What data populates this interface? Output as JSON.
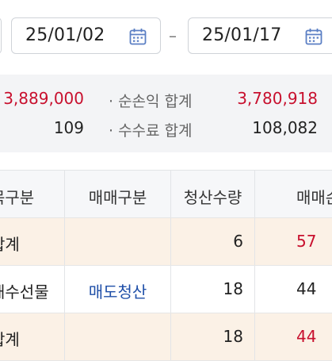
{
  "date_range": {
    "start": "25/01/02",
    "separator": "–",
    "end": "25/01/17",
    "icon": "calendar-icon"
  },
  "summary": {
    "row1": {
      "left_value": "3,889,000",
      "label": "· 순손익 합계",
      "right_value": "3,780,918"
    },
    "row2": {
      "left_value": "109",
      "label": "· 수수료 합계",
      "right_value": "108,082"
    }
  },
  "table": {
    "headers": [
      "목구분",
      "매매구분",
      "청산수량",
      "매매손"
    ],
    "rows": [
      {
        "col1": "합계",
        "col2": "",
        "col3": "6",
        "col4": "57"
      },
      {
        "col1": "해수선물",
        "col2": "매도청산",
        "col3": "18",
        "col4": "44"
      },
      {
        "col1": "합계",
        "col2": "",
        "col3": "18",
        "col4": "44"
      }
    ]
  },
  "colors": {
    "profit_red": "#c8102e",
    "link_blue": "#1f4fa8",
    "total_row_bg": "#fbf1e6",
    "summary_bg": "#f3f4f6",
    "icon_blue": "#5b7fc4"
  }
}
